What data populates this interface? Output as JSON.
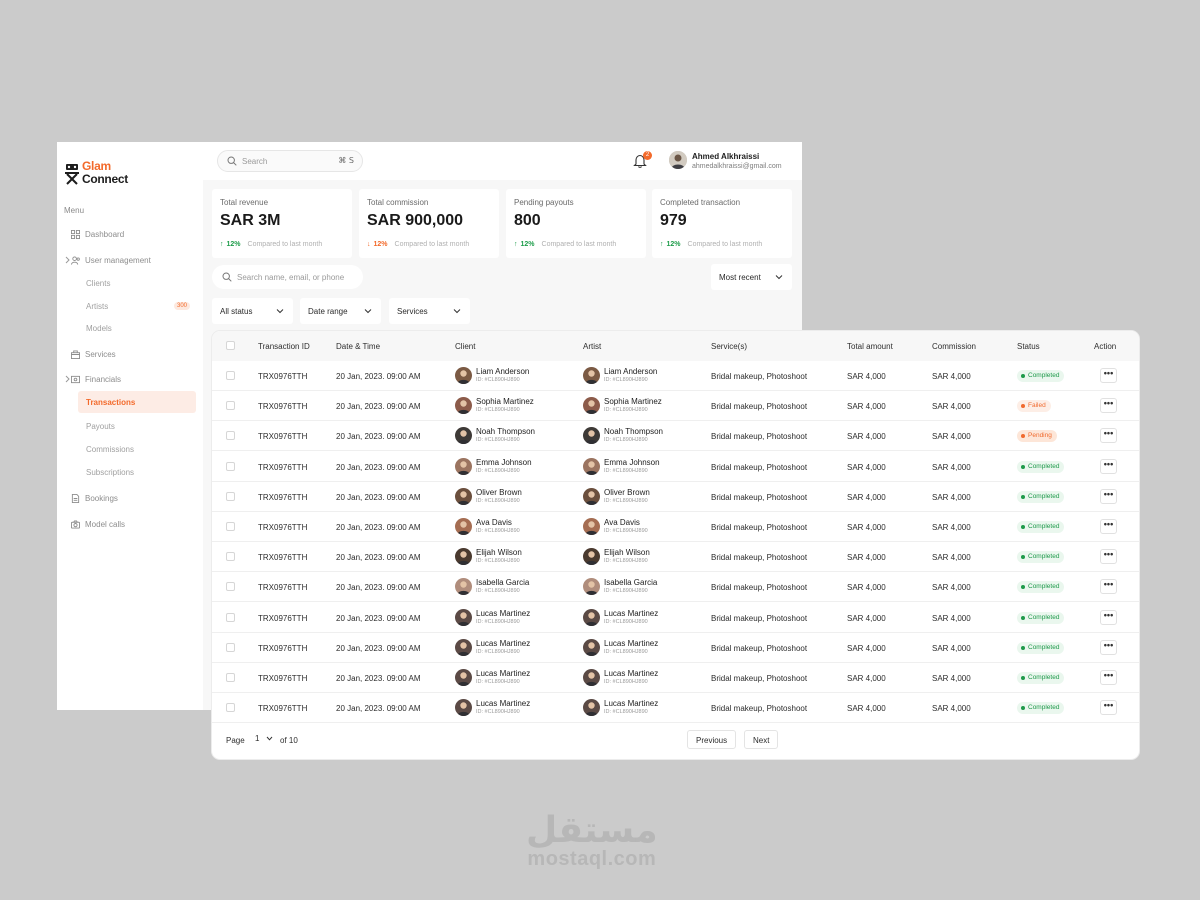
{
  "brand": {
    "line1": "Glam",
    "line2": "Connect",
    "accent": "#f36a2b"
  },
  "sidebar": {
    "menu_label": "Menu",
    "items": [
      {
        "label": "Dashboard",
        "icon": "dashboard-icon"
      },
      {
        "label": "User management",
        "icon": "users-icon"
      },
      {
        "label": "Services",
        "icon": "services-icon"
      },
      {
        "label": "Financials",
        "icon": "wallet-icon"
      },
      {
        "label": "Bookings",
        "icon": "bookings-icon"
      },
      {
        "label": "Model calls",
        "icon": "camera-icon"
      }
    ],
    "user_sub": [
      {
        "label": "Clients"
      },
      {
        "label": "Artists",
        "badge": "300"
      },
      {
        "label": "Models"
      }
    ],
    "fin_sub": [
      {
        "label": "Transactions",
        "active": true
      },
      {
        "label": "Payouts"
      },
      {
        "label": "Commissions"
      },
      {
        "label": "Subscriptions"
      }
    ]
  },
  "topbar": {
    "search_placeholder": "Search",
    "shortcut": "⌘ S",
    "notif_count": "2",
    "user_name": "Ahmed Alkhraissi",
    "user_email": "ahmedalkhraissi@gmail.com"
  },
  "stats": [
    {
      "label": "Total revenue",
      "value": "SAR 3M",
      "trend": "up",
      "pct": "12%",
      "compare": "Compared to last month"
    },
    {
      "label": "Total commission",
      "value": "SAR 900,000",
      "trend": "down",
      "pct": "12%",
      "compare": "Compared to last month"
    },
    {
      "label": "Pending payouts",
      "value": "800",
      "trend": "up",
      "pct": "12%",
      "compare": "Compared to last month"
    },
    {
      "label": "Completed transaction",
      "value": "979",
      "trend": "up",
      "pct": "12%",
      "compare": "Compared to last month"
    }
  ],
  "filters": {
    "search_placeholder": "Search name, email, or phone",
    "sort": "Most recent",
    "status": "All status",
    "date": "Date range",
    "services": "Services"
  },
  "table": {
    "headers": [
      "Transaction ID",
      "Date & Time",
      "Client",
      "Artist",
      "Service(s)",
      "Total amount",
      "Commission",
      "Status",
      "Action"
    ],
    "rows": [
      {
        "id": "TRX0976TTH",
        "date": "20 Jan, 2023. 09:00 AM",
        "client": "Liam Anderson",
        "client_id": "ID: #CL890HJ890",
        "artist": "Liam Anderson",
        "artist_id": "ID: #CL890HJ890",
        "services": "Bridal makeup, Photoshoot",
        "amount": "SAR 4,000",
        "commission": "SAR 4,000",
        "status": "Completed"
      },
      {
        "id": "TRX0976TTH",
        "date": "20 Jan, 2023. 09:00 AM",
        "client": "Sophia Martinez",
        "client_id": "ID: #CL890HJ890",
        "artist": "Sophia Martinez",
        "artist_id": "ID: #CL890HJ890",
        "services": "Bridal makeup, Photoshoot",
        "amount": "SAR 4,000",
        "commission": "SAR 4,000",
        "status": "Failed"
      },
      {
        "id": "TRX0976TTH",
        "date": "20 Jan, 2023. 09:00 AM",
        "client": "Noah Thompson",
        "client_id": "ID: #CL890HJ890",
        "artist": "Noah Thompson",
        "artist_id": "ID: #CL890HJ890",
        "services": "Bridal makeup, Photoshoot",
        "amount": "SAR 4,000",
        "commission": "SAR 4,000",
        "status": "Pending"
      },
      {
        "id": "TRX0976TTH",
        "date": "20 Jan, 2023. 09:00 AM",
        "client": "Emma Johnson",
        "client_id": "ID: #CL890HJ890",
        "artist": "Emma Johnson",
        "artist_id": "ID: #CL890HJ890",
        "services": "Bridal makeup, Photoshoot",
        "amount": "SAR 4,000",
        "commission": "SAR 4,000",
        "status": "Completed"
      },
      {
        "id": "TRX0976TTH",
        "date": "20 Jan, 2023. 09:00 AM",
        "client": "Oliver Brown",
        "client_id": "ID: #CL890HJ890",
        "artist": "Oliver Brown",
        "artist_id": "ID: #CL890HJ890",
        "services": "Bridal makeup, Photoshoot",
        "amount": "SAR 4,000",
        "commission": "SAR 4,000",
        "status": "Completed"
      },
      {
        "id": "TRX0976TTH",
        "date": "20 Jan, 2023. 09:00 AM",
        "client": "Ava Davis",
        "client_id": "ID: #CL890HJ890",
        "artist": "Ava Davis",
        "artist_id": "ID: #CL890HJ890",
        "services": "Bridal makeup, Photoshoot",
        "amount": "SAR 4,000",
        "commission": "SAR 4,000",
        "status": "Completed"
      },
      {
        "id": "TRX0976TTH",
        "date": "20 Jan, 2023. 09:00 AM",
        "client": "Elijah Wilson",
        "client_id": "ID: #CL890HJ890",
        "artist": "Elijah Wilson",
        "artist_id": "ID: #CL890HJ890",
        "services": "Bridal makeup, Photoshoot",
        "amount": "SAR 4,000",
        "commission": "SAR 4,000",
        "status": "Completed"
      },
      {
        "id": "TRX0976TTH",
        "date": "20 Jan, 2023. 09:00 AM",
        "client": "Isabella Garcia",
        "client_id": "ID: #CL890HJ890",
        "artist": "Isabella Garcia",
        "artist_id": "ID: #CL890HJ890",
        "services": "Bridal makeup, Photoshoot",
        "amount": "SAR 4,000",
        "commission": "SAR 4,000",
        "status": "Completed"
      },
      {
        "id": "TRX0976TTH",
        "date": "20 Jan, 2023. 09:00 AM",
        "client": "Lucas Martinez",
        "client_id": "ID: #CL890HJ890",
        "artist": "Lucas Martinez",
        "artist_id": "ID: #CL890HJ890",
        "services": "Bridal makeup, Photoshoot",
        "amount": "SAR 4,000",
        "commission": "SAR 4,000",
        "status": "Completed"
      },
      {
        "id": "TRX0976TTH",
        "date": "20 Jan, 2023. 09:00 AM",
        "client": "Lucas Martinez",
        "client_id": "ID: #CL890HJ890",
        "artist": "Lucas Martinez",
        "artist_id": "ID: #CL890HJ890",
        "services": "Bridal makeup, Photoshoot",
        "amount": "SAR 4,000",
        "commission": "SAR 4,000",
        "status": "Completed"
      },
      {
        "id": "TRX0976TTH",
        "date": "20 Jan, 2023. 09:00 AM",
        "client": "Lucas Martinez",
        "client_id": "ID: #CL890HJ890",
        "artist": "Lucas Martinez",
        "artist_id": "ID: #CL890HJ890",
        "services": "Bridal makeup, Photoshoot",
        "amount": "SAR 4,000",
        "commission": "SAR 4,000",
        "status": "Completed"
      },
      {
        "id": "TRX0976TTH",
        "date": "20 Jan, 2023. 09:00 AM",
        "client": "Lucas Martinez",
        "client_id": "ID: #CL890HJ890",
        "artist": "Lucas Martinez",
        "artist_id": "ID: #CL890HJ890",
        "services": "Bridal makeup, Photoshoot",
        "amount": "SAR 4,000",
        "commission": "SAR 4,000",
        "status": "Completed"
      }
    ],
    "action_label": "•••"
  },
  "pagination": {
    "page_label": "Page",
    "page": "1",
    "of_label": "of 10",
    "prev": "Previous",
    "next": "Next"
  },
  "watermark": {
    "arabic": "مستقل",
    "latin": "mostaql.com"
  }
}
